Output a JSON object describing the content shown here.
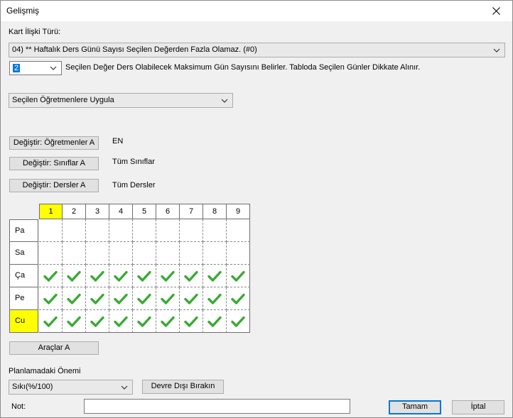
{
  "window": {
    "title": "Gelişmiş"
  },
  "relation": {
    "label": "Kart İlişki Türü:",
    "selected": "04) ** Haftalık Ders Günü Sayısı Seçilen Değerden Fazla Olamaz. (#0)"
  },
  "count": {
    "value": "2",
    "description": "Seçilen Değer Ders Olabilecek Maksimum Gün Sayısını Belirler. Tabloda Seçilen Günler Dikkate Alınır."
  },
  "apply": {
    "selected": "Seçilen Öğretmenlere Uygula"
  },
  "change": {
    "teachers_button": "Değiştir: Öğretmenler A",
    "teachers_value": "EN",
    "classes_button": "Değiştir: Sınıflar A",
    "classes_value": "Tüm Sınıflar",
    "subjects_button": "Değiştir: Dersler A",
    "subjects_value": "Tüm Dersler"
  },
  "grid": {
    "periods": [
      "1",
      "2",
      "3",
      "4",
      "5",
      "6",
      "7",
      "8",
      "9"
    ],
    "highlight_period": 0,
    "days": [
      {
        "label": "Pa",
        "checks": [
          false,
          false,
          false,
          false,
          false,
          false,
          false,
          false,
          false
        ]
      },
      {
        "label": "Sa",
        "checks": [
          false,
          false,
          false,
          false,
          false,
          false,
          false,
          false,
          false
        ]
      },
      {
        "label": "Ça",
        "checks": [
          true,
          true,
          true,
          true,
          true,
          true,
          true,
          true,
          true
        ]
      },
      {
        "label": "Pe",
        "checks": [
          true,
          true,
          true,
          true,
          true,
          true,
          true,
          true,
          true
        ]
      },
      {
        "label": "Cu",
        "checks": [
          true,
          true,
          true,
          true,
          true,
          true,
          true,
          true,
          true
        ]
      }
    ],
    "highlight_day": 4,
    "highlight_color": "#ffff00",
    "check_color": "#3aaa35"
  },
  "tools_button": "Araçlar A",
  "importance": {
    "label": "Planlamadaki Önemi",
    "selected": "Sıkı(%/100)",
    "disable_button": "Devre Dışı Bırakın"
  },
  "note": {
    "label": "Not:",
    "value": ""
  },
  "footer": {
    "ok_button": "Tamam",
    "cancel_button": "İptal"
  }
}
